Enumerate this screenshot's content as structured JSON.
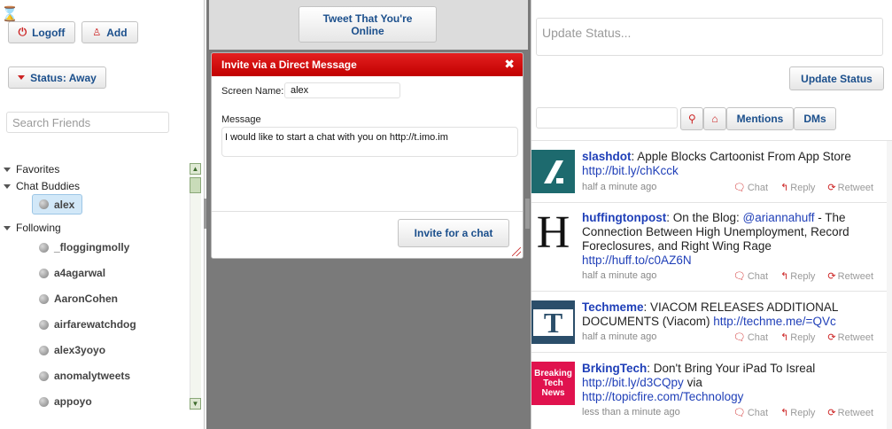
{
  "left": {
    "logoff_label": "Logoff",
    "add_label": "Add",
    "status_label": "Status: Away",
    "search_placeholder": "Search Friends",
    "groups": {
      "favorites": "Favorites",
      "chat_buddies": "Chat Buddies",
      "selected_buddy": "alex",
      "following": "Following"
    },
    "following": [
      "_floggingmolly",
      "a4agarwal",
      "AaronCohen",
      "airfarewatchdog",
      "alex3yoyo",
      "anomalytweets",
      "appoyo"
    ]
  },
  "middle": {
    "tweet_online_label": "Tweet That You're Online",
    "dialog": {
      "title": "Invite via a Direct Message",
      "screen_name_label": "Screen Name:",
      "screen_name_value": "alex",
      "message_label": "Message",
      "message_value": "I would like to start a chat with you on http://t.imo.im",
      "invite_label": "Invite for a chat"
    }
  },
  "right": {
    "status_placeholder": "Update Status...",
    "update_label": "Update Status",
    "mentions_label": "Mentions",
    "dms_label": "DMs",
    "actions": {
      "chat": "Chat",
      "reply": "Reply",
      "retweet": "Retweet"
    },
    "tweets": [
      {
        "user": "slashdot",
        "text": ": Apple Blocks Cartoonist From App Store ",
        "link": "http://bit.ly/chKcck",
        "extra": "",
        "link2": "",
        "age": "half a minute ago",
        "avatar_text": "",
        "avatar_color": "#1d6a6e"
      },
      {
        "user": "huffingtonpost",
        "text": ": On the Blog: ",
        "mention": "@ariannahuff",
        "text2": " - The Connection Between High Unemployment, Record Foreclosures, and Right Wing Rage ",
        "link": "http://huff.to/c0AZ6N",
        "age": "half a minute ago",
        "avatar_text": "H",
        "avatar_color": "#ffffff"
      },
      {
        "user": "Techmeme",
        "text": ": VIACOM RELEASES ADDITIONAL DOCUMENTS (Viacom) ",
        "link": "http://techme.me/=QVc",
        "age": "half a minute ago",
        "avatar_text": "T",
        "avatar_color": "#2b4e6a"
      },
      {
        "user": "BrkingTech",
        "text": ": Don't Bring Your iPad To Isreal ",
        "link": "http://bit.ly/d3CQpy",
        "mid": " via ",
        "link2": "http://topicfire.com/Technology",
        "age": "less than a minute ago",
        "avatar_text": "Breaking Tech News",
        "avatar_color": "#e0124e"
      }
    ]
  },
  "colors": {
    "accent_red": "#cc1111",
    "link_blue": "#1f3fb8",
    "dialog_header": "#cc0000"
  }
}
